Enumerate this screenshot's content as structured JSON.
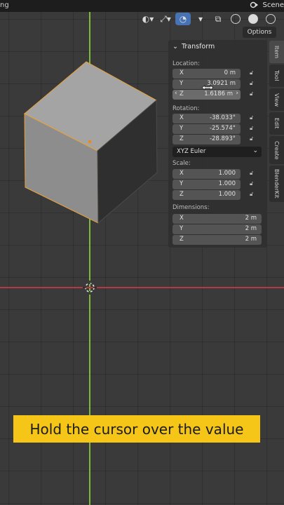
{
  "topbar": {
    "clip_text": "ng",
    "scene_label": "Scene"
  },
  "header": {
    "options_label": "Options"
  },
  "panel": {
    "title": "Transform",
    "location_label": "Location:",
    "location": [
      {
        "axis": "X",
        "value": "0 m"
      },
      {
        "axis": "Y",
        "value": "3.0921 m"
      },
      {
        "axis": "Z",
        "value": "1.6186 m"
      }
    ],
    "rotation_label": "Rotation:",
    "rotation": [
      {
        "axis": "X",
        "value": "-38.033°"
      },
      {
        "axis": "Y",
        "value": "-25.574°"
      },
      {
        "axis": "Z",
        "value": "-28.893°"
      }
    ],
    "rotation_mode": "XYZ Euler",
    "scale_label": "Scale:",
    "scale": [
      {
        "axis": "X",
        "value": "1.000"
      },
      {
        "axis": "Y",
        "value": "1.000"
      },
      {
        "axis": "Z",
        "value": "1.000"
      }
    ],
    "dimensions_label": "Dimensions:",
    "dimensions": [
      {
        "axis": "X",
        "value": "2 m"
      },
      {
        "axis": "Y",
        "value": "2 m"
      },
      {
        "axis": "Z",
        "value": "2 m"
      }
    ]
  },
  "tabs": [
    "Item",
    "Tool",
    "View",
    "Edit",
    "Create",
    "BlenderKit"
  ],
  "caption": "Hold the cursor over the value",
  "colors": {
    "caption_bg": "#f5c518",
    "active_blue": "#4772b3",
    "y_axis": "#7fb83a",
    "x_axis": "#b23a48"
  }
}
